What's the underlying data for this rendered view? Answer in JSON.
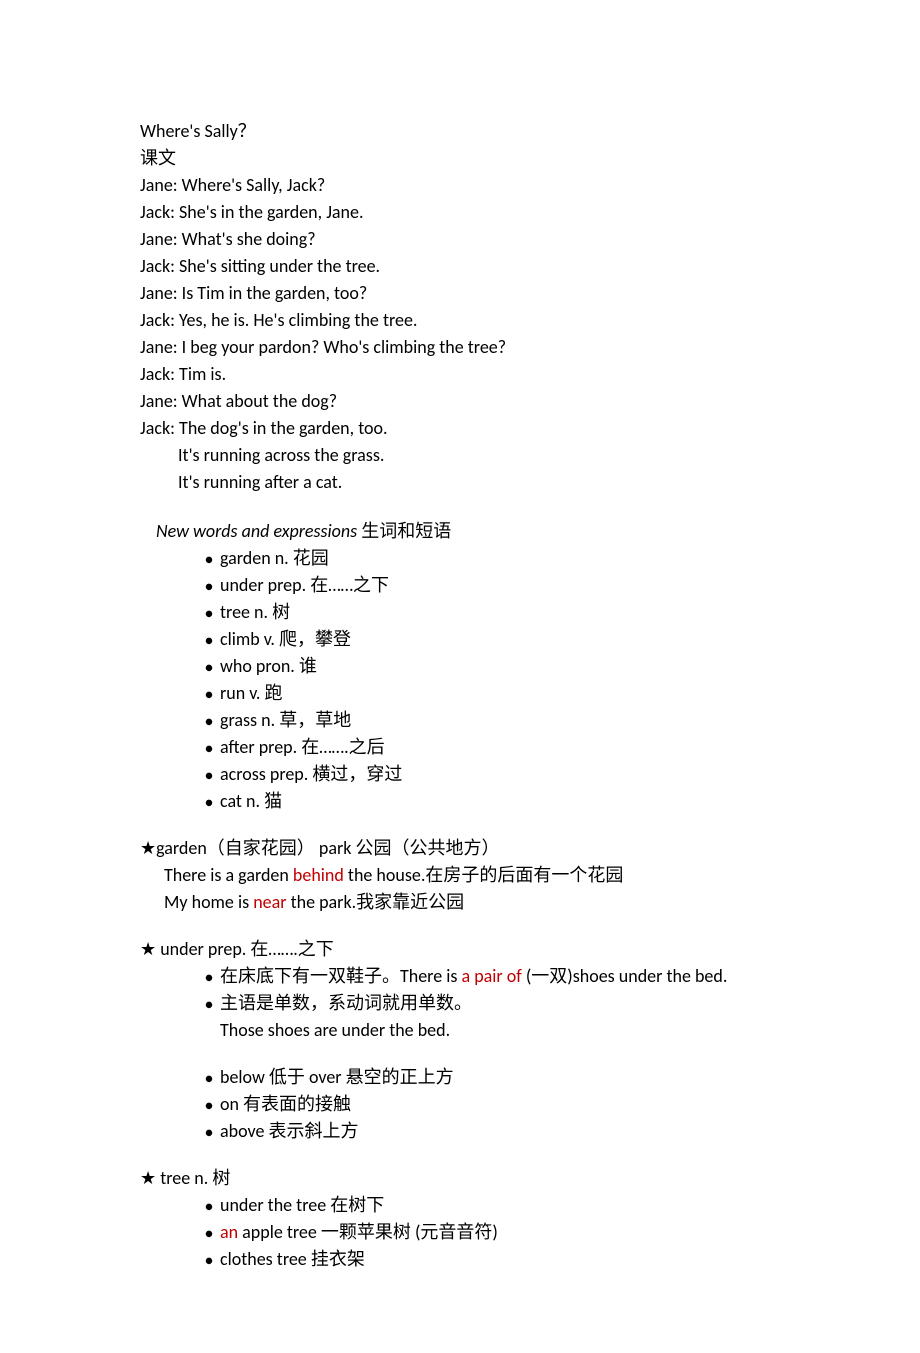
{
  "title": "Where's Sally？",
  "subtitle": "课文",
  "dialogue": [
    "Jane: Where's Sally, Jack?",
    "Jack: She's in the garden, Jane.",
    "Jane: What's she doing?",
    "Jack: She's sitting under the tree.",
    "Jane: Is Tim in the garden, too?",
    "Jack: Yes, he is. He's climbing the tree.",
    "Jane: I beg your pardon? Who's climbing the tree?",
    "Jack: Tim is.",
    "Jane: What about the dog?",
    "Jack: The dog's in the garden, too."
  ],
  "dialogue_indent": [
    "It's running across the grass.",
    "It's running after a cat."
  ],
  "section_header_prefix": "New words and expressions",
  "section_header_suffix": "   生词和短语",
  "vocab": [
    "garden    n.  花园",
    "under    prep.  在……之下",
    "tree    n.  树",
    "climb    v.  爬，攀登",
    "who    pron.  谁",
    "run    v.  跑",
    "grass    n.  草，草地",
    "after    prep.  在…….之后",
    "across    prep.  横过，穿过",
    "cat    n.  猫"
  ],
  "garden_note": {
    "star": "★",
    "line": "garden（自家花园）       park  公园（公共地方）",
    "ex1_pre": "There is a garden ",
    "ex1_red": "behind",
    "ex1_post": " the house.在房子的后面有一个花园",
    "ex2_pre": "My home is ",
    "ex2_red": "near",
    "ex2_post": " the park.我家靠近公园"
  },
  "under_note": {
    "star": "★",
    "head": "  under prep.  在…….之下",
    "b1_pre": "在床底下有一双鞋子。There is ",
    "b1_red": "a pair of ",
    "b1_post": "(一双)shoes under the bed.",
    "b2": "主语是单数，系动词就用单数。",
    "b2_sub": "Those shoes are under the bed.",
    "b3": "below  低于    over  悬空的正上方",
    "b4": "on  有表面的接触",
    "b5": "above  表示斜上方"
  },
  "tree_note": {
    "star": "★",
    "head": "  tree n.  树",
    "b1": "under the tree    在树下",
    "b2_red": "an",
    "b2_post": " apple tree    一颗苹果树  (元音音符)",
    "b3": "clothes tree    挂衣架"
  }
}
